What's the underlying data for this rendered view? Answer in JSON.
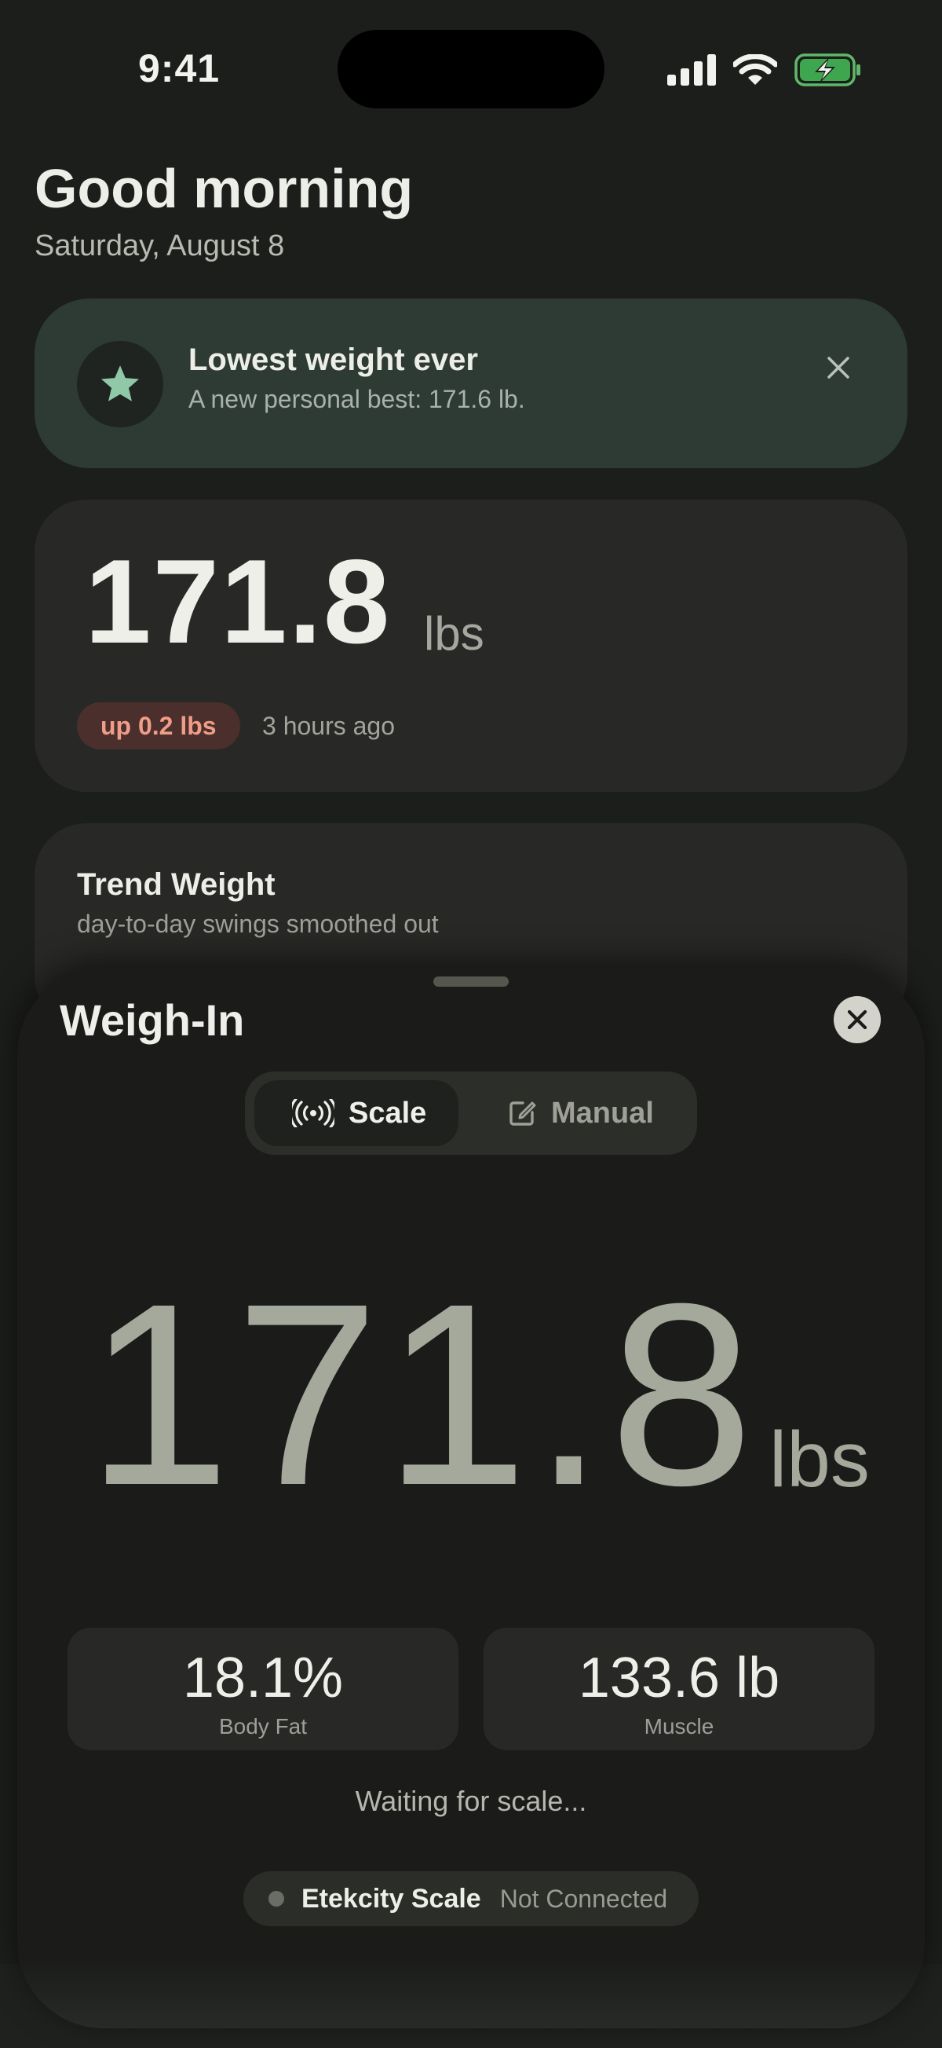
{
  "status_bar": {
    "time": "9:41"
  },
  "header": {
    "greeting": "Good morning",
    "date": "Saturday, August 8"
  },
  "achievement": {
    "title": "Lowest weight ever",
    "subtitle": "A new personal best: 171.6 lb.",
    "icon": "star-icon",
    "accent": "#8fc9a8"
  },
  "latest_weight": {
    "value": "171.8",
    "unit": "lbs",
    "change": "up 0.2 lbs",
    "time_ago": "3 hours ago"
  },
  "trend": {
    "title": "Trend Weight",
    "subtitle": "day-to-day swings smoothed out"
  },
  "sheet": {
    "title": "Weigh-In",
    "segments": {
      "scale": "Scale",
      "manual": "Manual",
      "selected": "Scale"
    },
    "reading": {
      "value": "171.8",
      "unit": "lbs"
    },
    "stats": [
      {
        "value": "18.1%",
        "label": "Body Fat"
      },
      {
        "value": "133.6 lb",
        "label": "Muscle"
      }
    ],
    "waiting_text": "Waiting for scale...",
    "device": {
      "name": "Etekcity Scale",
      "status": "Not Connected"
    }
  }
}
